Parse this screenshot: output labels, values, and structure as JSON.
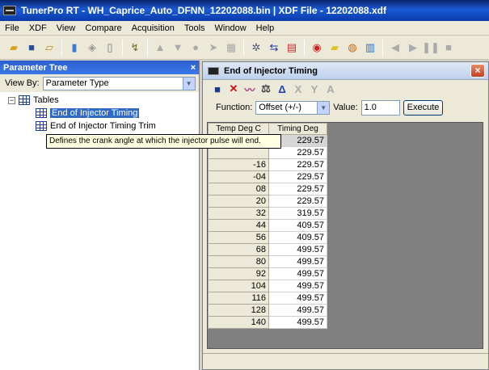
{
  "window": {
    "title": "TunerPro RT - WH_Caprice_Auto_DFNN_12202088.bin | XDF File - 12202088.xdf"
  },
  "menu": [
    "File",
    "XDF",
    "View",
    "Compare",
    "Acquisition",
    "Tools",
    "Window",
    "Help"
  ],
  "toolbar_icons": [
    "open-folder-icon",
    "save-icon",
    "open-icon",
    "bin-icon",
    "export-icon",
    "new-doc-icon",
    "probe-icon",
    "up-arrow-icon",
    "down-arrow-icon",
    "circle-icon",
    "next-icon",
    "chip-icon",
    "settings-icon",
    "transfer-icon",
    "register-icon",
    "stop-icon",
    "note-icon",
    "emulator-icon",
    "chart-icon",
    "play-icon",
    "step-icon",
    "pause-icon",
    "stop-square-icon"
  ],
  "parameter_tree": {
    "title": "Parameter Tree",
    "close": "×",
    "view_by_label": "View By:",
    "view_by_value": "Parameter Type",
    "root": "Tables",
    "expander": "−",
    "items": [
      "End of Injector Timing",
      "End of Injector Timing Trim"
    ],
    "tooltip": "Defines the crank angle at which the injector pulse will end."
  },
  "table_window": {
    "title": "End of Injector Timing",
    "close": "×",
    "function_label": "Function:",
    "function_value": "Offset (+/-)",
    "value_label": "Value:",
    "value": "1.0",
    "execute": "Execute",
    "col_headers": [
      "Temp Deg C",
      "Timing Deg"
    ],
    "rows": [
      {
        "label": "",
        "value": "229.57"
      },
      {
        "label": "",
        "value": "229.57"
      },
      {
        "label": "-16",
        "value": "229.57"
      },
      {
        "label": "-04",
        "value": "229.57"
      },
      {
        "label": "08",
        "value": "229.57"
      },
      {
        "label": "20",
        "value": "229.57"
      },
      {
        "label": "32",
        "value": "319.57"
      },
      {
        "label": "44",
        "value": "409.57"
      },
      {
        "label": "56",
        "value": "409.57"
      },
      {
        "label": "68",
        "value": "499.57"
      },
      {
        "label": "80",
        "value": "499.57"
      },
      {
        "label": "92",
        "value": "499.57"
      },
      {
        "label": "104",
        "value": "499.57"
      },
      {
        "label": "116",
        "value": "499.57"
      },
      {
        "label": "128",
        "value": "499.57"
      },
      {
        "label": "140",
        "value": "499.57"
      }
    ]
  }
}
